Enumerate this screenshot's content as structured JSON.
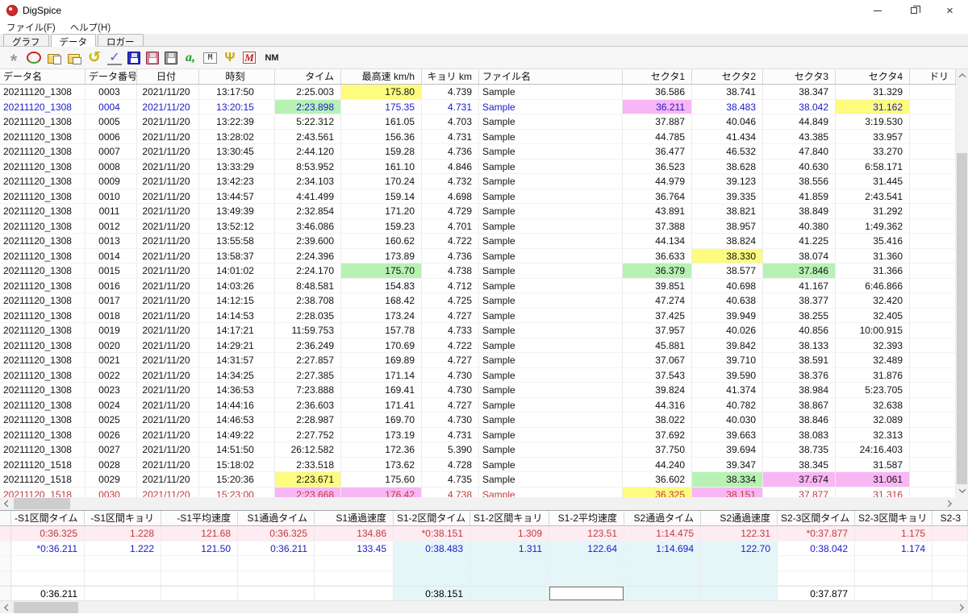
{
  "window": {
    "title": "DigSpice"
  },
  "menu": {
    "items": [
      "ファイル(F)",
      "ヘルプ(H)"
    ]
  },
  "tabs": [
    {
      "label": "グラフ",
      "active": false
    },
    {
      "label": "データ",
      "active": true
    },
    {
      "label": "ロガー",
      "active": false
    }
  ],
  "toolbar": {
    "icons": [
      {
        "name": "busy-icon",
        "kind": "star"
      },
      {
        "name": "ellipse-icon",
        "kind": "oval"
      },
      {
        "name": "folder-copy-icon",
        "kind": "folder"
      },
      {
        "name": "folder-open-icon",
        "kind": "folder2"
      },
      {
        "name": "undo-icon",
        "kind": "undo"
      },
      {
        "name": "chart-check-icon",
        "kind": "check"
      },
      {
        "name": "save-blue-icon",
        "kind": "floppy floppy-blue"
      },
      {
        "name": "save-pink-icon",
        "kind": "floppy floppy-pink"
      },
      {
        "name": "save-gray-icon",
        "kind": "floppy floppy-gray"
      },
      {
        "name": "autotext-icon",
        "kind": "a",
        "label": "a,"
      },
      {
        "name": "waveform-icon",
        "kind": "wave",
        "label": "M"
      },
      {
        "name": "marker-icon",
        "kind": "psi",
        "label": "Ψ"
      },
      {
        "name": "motec-icon",
        "kind": "m",
        "label": "M"
      },
      {
        "name": "nm-button",
        "kind": "nm",
        "label": "NM"
      }
    ]
  },
  "colors": {
    "accent_blue": "#1a1acc",
    "record_red": "#c23a3a",
    "hl_yellow": "#fdfc7f",
    "hl_green": "#b7f2b4",
    "hl_magenta": "#f9b6f4",
    "zone_cyan": "#e4f6f8",
    "row_pink": "#fdecf2"
  },
  "main_table": {
    "columns": [
      "データ名",
      "データ番号",
      "日付",
      "時刻",
      "タイム",
      "最高速 km/h",
      "キョリ km",
      "ファイル名",
      "セクタ1",
      "セクタ2",
      "セクタ3",
      "セクタ4",
      "ドリ"
    ],
    "rows": [
      {
        "cells": [
          "20211120_1308",
          "0003",
          "2021/11/20",
          "13:17:50",
          "2:25.003",
          "175.80",
          "4.739",
          "Sample",
          "36.586",
          "38.741",
          "38.347",
          "31.329",
          ""
        ],
        "hl": {
          "5": "yellow"
        }
      },
      {
        "cells": [
          "20211120_1308",
          "0004",
          "2021/11/20",
          "13:20:15",
          "2:23.898",
          "175.35",
          "4.731",
          "Sample",
          "36.211",
          "38.483",
          "38.042",
          "31.162",
          ""
        ],
        "color": "blue",
        "hl": {
          "4": "green",
          "8": "magenta",
          "11": "yellow"
        }
      },
      {
        "cells": [
          "20211120_1308",
          "0005",
          "2021/11/20",
          "13:22:39",
          "5:22.312",
          "161.05",
          "4.703",
          "Sample",
          "37.887",
          "40.046",
          "44.849",
          "3:19.530",
          ""
        ]
      },
      {
        "cells": [
          "20211120_1308",
          "0006",
          "2021/11/20",
          "13:28:02",
          "2:43.561",
          "156.36",
          "4.731",
          "Sample",
          "44.785",
          "41.434",
          "43.385",
          "33.957",
          ""
        ]
      },
      {
        "cells": [
          "20211120_1308",
          "0007",
          "2021/11/20",
          "13:30:45",
          "2:44.120",
          "159.28",
          "4.736",
          "Sample",
          "36.477",
          "46.532",
          "47.840",
          "33.270",
          ""
        ]
      },
      {
        "cells": [
          "20211120_1308",
          "0008",
          "2021/11/20",
          "13:33:29",
          "8:53.952",
          "161.10",
          "4.846",
          "Sample",
          "36.523",
          "38.628",
          "40.630",
          "6:58.171",
          ""
        ]
      },
      {
        "cells": [
          "20211120_1308",
          "0009",
          "2021/11/20",
          "13:42:23",
          "2:34.103",
          "170.24",
          "4.732",
          "Sample",
          "44.979",
          "39.123",
          "38.556",
          "31.445",
          ""
        ]
      },
      {
        "cells": [
          "20211120_1308",
          "0010",
          "2021/11/20",
          "13:44:57",
          "4:41.499",
          "159.14",
          "4.698",
          "Sample",
          "36.764",
          "39.335",
          "41.859",
          "2:43.541",
          ""
        ]
      },
      {
        "cells": [
          "20211120_1308",
          "0011",
          "2021/11/20",
          "13:49:39",
          "2:32.854",
          "171.20",
          "4.729",
          "Sample",
          "43.891",
          "38.821",
          "38.849",
          "31.292",
          ""
        ]
      },
      {
        "cells": [
          "20211120_1308",
          "0012",
          "2021/11/20",
          "13:52:12",
          "3:46.086",
          "159.23",
          "4.701",
          "Sample",
          "37.388",
          "38.957",
          "40.380",
          "1:49.362",
          ""
        ]
      },
      {
        "cells": [
          "20211120_1308",
          "0013",
          "2021/11/20",
          "13:55:58",
          "2:39.600",
          "160.62",
          "4.722",
          "Sample",
          "44.134",
          "38.824",
          "41.225",
          "35.416",
          ""
        ]
      },
      {
        "cells": [
          "20211120_1308",
          "0014",
          "2021/11/20",
          "13:58:37",
          "2:24.396",
          "173.89",
          "4.736",
          "Sample",
          "36.633",
          "38.330",
          "38.074",
          "31.360",
          ""
        ],
        "hl": {
          "9": "yellow"
        }
      },
      {
        "cells": [
          "20211120_1308",
          "0015",
          "2021/11/20",
          "14:01:02",
          "2:24.170",
          "175.70",
          "4.738",
          "Sample",
          "36.379",
          "38.577",
          "37.846",
          "31.366",
          ""
        ],
        "hl": {
          "5": "green",
          "8": "green",
          "10": "green"
        }
      },
      {
        "cells": [
          "20211120_1308",
          "0016",
          "2021/11/20",
          "14:03:26",
          "8:48.581",
          "154.83",
          "4.712",
          "Sample",
          "39.851",
          "40.698",
          "41.167",
          "6:46.866",
          ""
        ]
      },
      {
        "cells": [
          "20211120_1308",
          "0017",
          "2021/11/20",
          "14:12:15",
          "2:38.708",
          "168.42",
          "4.725",
          "Sample",
          "47.274",
          "40.638",
          "38.377",
          "32.420",
          ""
        ]
      },
      {
        "cells": [
          "20211120_1308",
          "0018",
          "2021/11/20",
          "14:14:53",
          "2:28.035",
          "173.24",
          "4.727",
          "Sample",
          "37.425",
          "39.949",
          "38.255",
          "32.405",
          ""
        ]
      },
      {
        "cells": [
          "20211120_1308",
          "0019",
          "2021/11/20",
          "14:17:21",
          "11:59.753",
          "157.78",
          "4.733",
          "Sample",
          "37.957",
          "40.026",
          "40.856",
          "10:00.915",
          ""
        ]
      },
      {
        "cells": [
          "20211120_1308",
          "0020",
          "2021/11/20",
          "14:29:21",
          "2:36.249",
          "170.69",
          "4.722",
          "Sample",
          "45.881",
          "39.842",
          "38.133",
          "32.393",
          ""
        ]
      },
      {
        "cells": [
          "20211120_1308",
          "0021",
          "2021/11/20",
          "14:31:57",
          "2:27.857",
          "169.89",
          "4.727",
          "Sample",
          "37.067",
          "39.710",
          "38.591",
          "32.489",
          ""
        ]
      },
      {
        "cells": [
          "20211120_1308",
          "0022",
          "2021/11/20",
          "14:34:25",
          "2:27.385",
          "171.14",
          "4.730",
          "Sample",
          "37.543",
          "39.590",
          "38.376",
          "31.876",
          ""
        ]
      },
      {
        "cells": [
          "20211120_1308",
          "0023",
          "2021/11/20",
          "14:36:53",
          "7:23.888",
          "169.41",
          "4.730",
          "Sample",
          "39.824",
          "41.374",
          "38.984",
          "5:23.705",
          ""
        ]
      },
      {
        "cells": [
          "20211120_1308",
          "0024",
          "2021/11/20",
          "14:44:16",
          "2:36.603",
          "171.41",
          "4.727",
          "Sample",
          "44.316",
          "40.782",
          "38.867",
          "32.638",
          ""
        ]
      },
      {
        "cells": [
          "20211120_1308",
          "0025",
          "2021/11/20",
          "14:46:53",
          "2:28.987",
          "169.70",
          "4.730",
          "Sample",
          "38.022",
          "40.030",
          "38.846",
          "32.089",
          ""
        ]
      },
      {
        "cells": [
          "20211120_1308",
          "0026",
          "2021/11/20",
          "14:49:22",
          "2:27.752",
          "173.19",
          "4.731",
          "Sample",
          "37.692",
          "39.663",
          "38.083",
          "32.313",
          ""
        ]
      },
      {
        "cells": [
          "20211120_1308",
          "0027",
          "2021/11/20",
          "14:51:50",
          "26:12.582",
          "172.36",
          "5.390",
          "Sample",
          "37.750",
          "39.694",
          "38.735",
          "24:16.403",
          ""
        ]
      },
      {
        "cells": [
          "20211120_1518",
          "0028",
          "2021/11/20",
          "15:18:02",
          "2:33.518",
          "173.62",
          "4.728",
          "Sample",
          "44.240",
          "39.347",
          "38.345",
          "31.587",
          ""
        ]
      },
      {
        "cells": [
          "20211120_1518",
          "0029",
          "2021/11/20",
          "15:20:36",
          "2:23.671",
          "175.60",
          "4.735",
          "Sample",
          "36.602",
          "38.334",
          "37.674",
          "31.061",
          ""
        ],
        "hl": {
          "4": "yellow",
          "9": "green",
          "10": "magenta",
          "11": "magenta"
        }
      },
      {
        "cells": [
          "20211120_1518",
          "0030",
          "2021/11/20",
          "15:23:00",
          "2:23.668",
          "176.42",
          "4.738",
          "Sample",
          "36.325",
          "38.151",
          "37.877",
          "31.316",
          ""
        ],
        "color": "red",
        "hl": {
          "4": "magenta",
          "5": "magenta",
          "8": "yellow",
          "9": "magenta"
        }
      }
    ]
  },
  "bottom_table": {
    "columns": [
      "-S1区間タイム",
      "-S1区間キョリ",
      "-S1平均速度",
      "S1通過タイム",
      "S1通過速度",
      "S1-2区間タイム",
      "S1-2区間キョリ",
      "S1-2平均速度",
      "S2通過タイム",
      "S2通過速度",
      "S2-3区間タイム",
      "S2-3区間キョリ",
      "S2-3"
    ],
    "cyan_columns": [
      5,
      9
    ],
    "rows": [
      {
        "cells": [
          "0:36.325",
          "1.228",
          "121.68",
          "0:36.325",
          "134.86",
          "*0:38.151",
          "1.309",
          "123.51",
          "1:14.475",
          "122.31",
          "*0:37.877",
          "1.175",
          ""
        ],
        "color": "red",
        "bg": "pink"
      },
      {
        "cells": [
          "*0:36.211",
          "1.222",
          "121.50",
          "0:36.211",
          "133.45",
          "0:38.483",
          "1.311",
          "122.64",
          "1:14.694",
          "122.70",
          "0:38.042",
          "1.174",
          ""
        ],
        "color": "blue"
      }
    ],
    "empty_rows": 2,
    "summary": {
      "cells": [
        "0:36.211",
        "",
        "",
        "",
        "",
        "0:38.151",
        "",
        "",
        "",
        "",
        "0:37.877",
        "",
        ""
      ],
      "focus_col": 7
    }
  }
}
